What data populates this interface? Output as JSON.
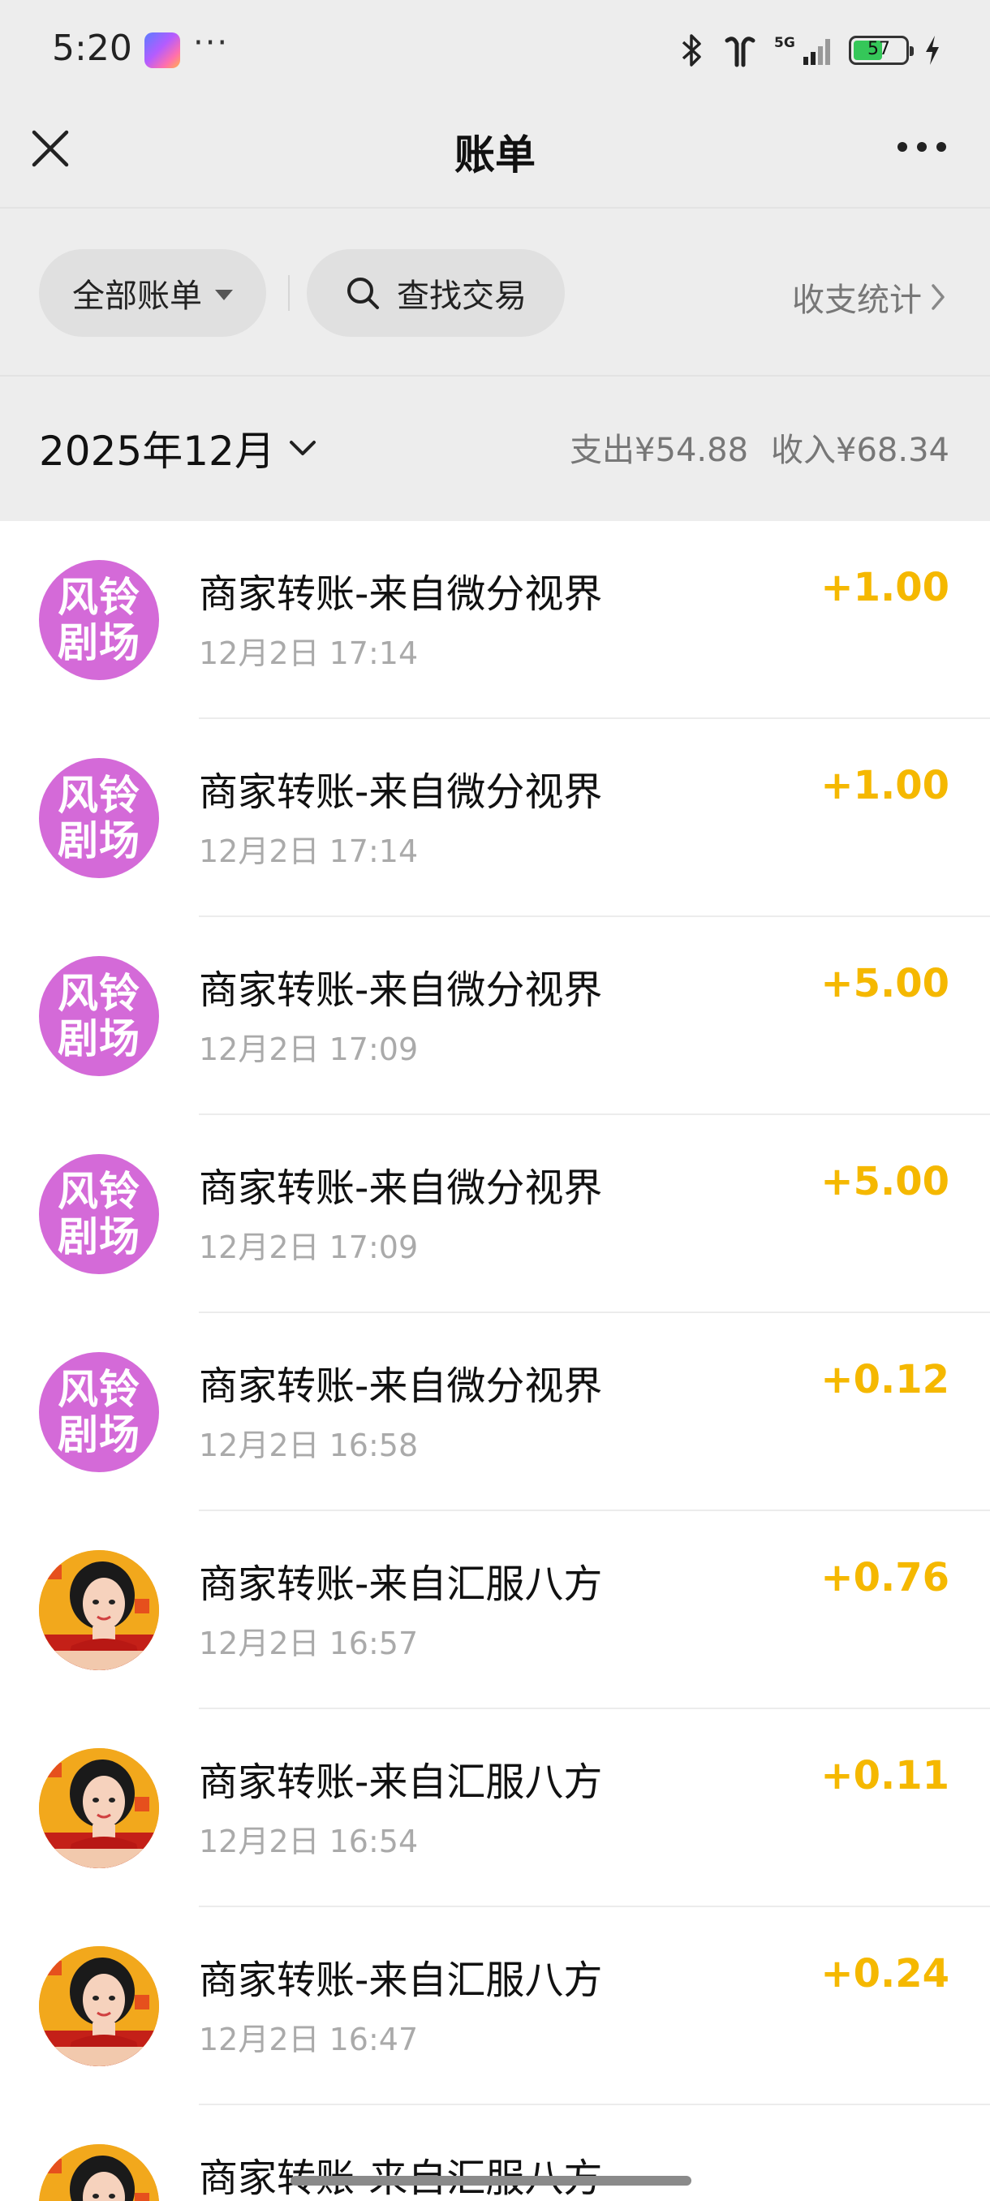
{
  "status_bar": {
    "time": "5:20",
    "dots": "···",
    "network": "5G",
    "battery": "57",
    "battery_level": 0.57
  },
  "nav": {
    "title": "账单"
  },
  "filters": {
    "all_label": "全部账单",
    "search_label": "查找交易",
    "stats_label": "收支统计"
  },
  "month": {
    "label": "2025年12月",
    "expense": "支出¥54.88",
    "income": "收入¥68.34"
  },
  "transactions": [
    {
      "title": "商家转账-来自微分视界",
      "time": "12月2日 17:14",
      "amount": "+1.00",
      "avatar": "风铃剧场",
      "avatar_line1": "风铃",
      "avatar_line2": "剧场"
    },
    {
      "title": "商家转账-来自微分视界",
      "time": "12月2日 17:14",
      "amount": "+1.00",
      "avatar": "风铃剧场",
      "avatar_line1": "风铃",
      "avatar_line2": "剧场"
    },
    {
      "title": "商家转账-来自微分视界",
      "time": "12月2日 17:09",
      "amount": "+5.00",
      "avatar": "风铃剧场",
      "avatar_line1": "风铃",
      "avatar_line2": "剧场"
    },
    {
      "title": "商家转账-来自微分视界",
      "time": "12月2日 17:09",
      "amount": "+5.00",
      "avatar": "风铃剧场",
      "avatar_line1": "风铃",
      "avatar_line2": "剧场"
    },
    {
      "title": "商家转账-来自微分视界",
      "time": "12月2日 16:58",
      "amount": "+0.12",
      "avatar": "风铃剧场",
      "avatar_line1": "风铃",
      "avatar_line2": "剧场"
    },
    {
      "title": "商家转账-来自汇服八方",
      "time": "12月2日 16:57",
      "amount": "+0.76",
      "avatar": "portrait"
    },
    {
      "title": "商家转账-来自汇服八方",
      "time": "12月2日 16:54",
      "amount": "+0.11",
      "avatar": "portrait"
    },
    {
      "title": "商家转账-来自汇服八方",
      "time": "12月2日 16:47",
      "amount": "+0.24",
      "avatar": "portrait"
    },
    {
      "title": "商家转账-来自汇服八方",
      "time": "",
      "amount": "",
      "avatar": "portrait"
    }
  ],
  "colors": {
    "income_amount": "#f5b800",
    "avatar_pink": "#d46ad8",
    "background": "#ededed"
  },
  "icons": [
    "back-close-icon",
    "more-icon",
    "dropdown-caret-icon",
    "search-icon",
    "chevron-right-icon",
    "chevron-down-icon",
    "bluetooth-icon",
    "earbuds-icon",
    "signal-icon",
    "battery-icon",
    "charging-icon"
  ]
}
